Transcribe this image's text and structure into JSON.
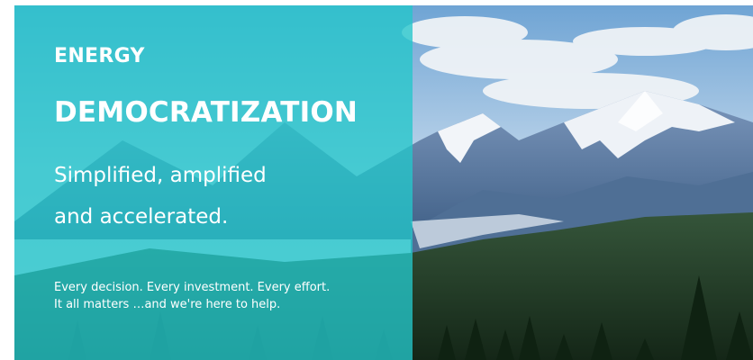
{
  "hero": {
    "eyebrow": "ENERGY",
    "headline": "DEMOCRATIZATION",
    "subhead_line1": "Simplified, amplified",
    "subhead_line2": "and accelerated.",
    "tagline_line1": "Every decision. Every investment. Every effort.",
    "tagline_line2": "It all matters …and we're here to help."
  },
  "colors": {
    "overlay_teal": "#24c6ca",
    "text": "#ffffff",
    "sky": "#9cc3e2",
    "mountain": "#5d7fa6",
    "snow": "#f2f5f9",
    "forest": "#1f3a22"
  }
}
